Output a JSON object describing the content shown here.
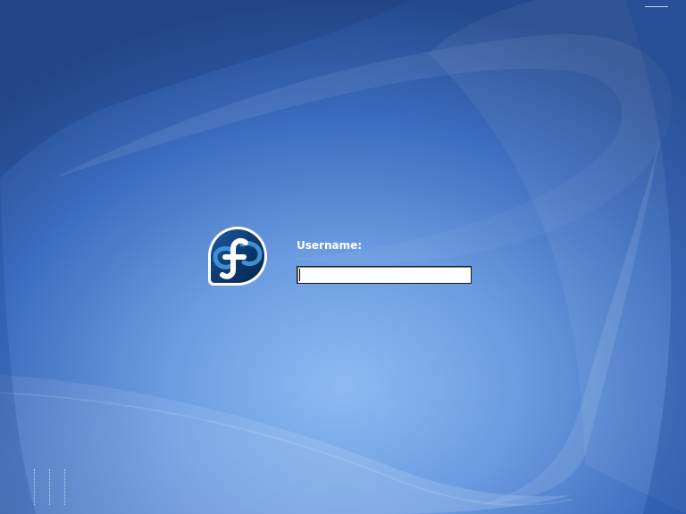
{
  "screen": "gdm-login",
  "clock": {
    "text": ""
  },
  "logo": {
    "icon": "fedora-logo-icon",
    "alt": ""
  },
  "login": {
    "username_label": "Username:",
    "username_value": "",
    "username_placeholder": ""
  },
  "bottom_menu": {
    "items": [
      {
        "label": "",
        "icon": "language-menu"
      },
      {
        "label": "",
        "icon": "session-menu"
      },
      {
        "label": "",
        "icon": "actions-menu"
      },
      {
        "label": "",
        "icon": "other-menu"
      }
    ]
  },
  "colors": {
    "background_dark": "#244c8f",
    "background_light": "#8ab9f2",
    "label_text": "#ffffff",
    "logo_blue": "#0b3d73"
  }
}
